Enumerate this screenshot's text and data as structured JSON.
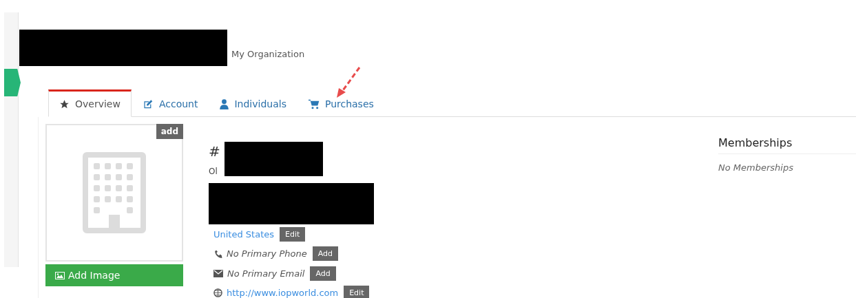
{
  "header": {
    "subtitle": "My Organization"
  },
  "tabs": [
    {
      "label": "Overview",
      "selected": true
    },
    {
      "label": "Account",
      "selected": false
    },
    {
      "label": "Individuals",
      "selected": false
    },
    {
      "label": "Purchases",
      "selected": false
    }
  ],
  "image_panel": {
    "add_label": "add",
    "button": "Add Image"
  },
  "details": {
    "number_prefix": "#",
    "old_prefix": "Ol",
    "rows": [
      {
        "kind": "country",
        "text": "United States",
        "button": "Edit"
      },
      {
        "kind": "phone",
        "text": "No Primary Phone",
        "button": "Add"
      },
      {
        "kind": "email",
        "text": "No Primary Email",
        "button": "Add"
      },
      {
        "kind": "website",
        "text": "http://www.iopworld.com",
        "button": "Edit"
      }
    ]
  },
  "memberships": {
    "title": "Memberships",
    "empty_text": "No Memberships"
  }
}
